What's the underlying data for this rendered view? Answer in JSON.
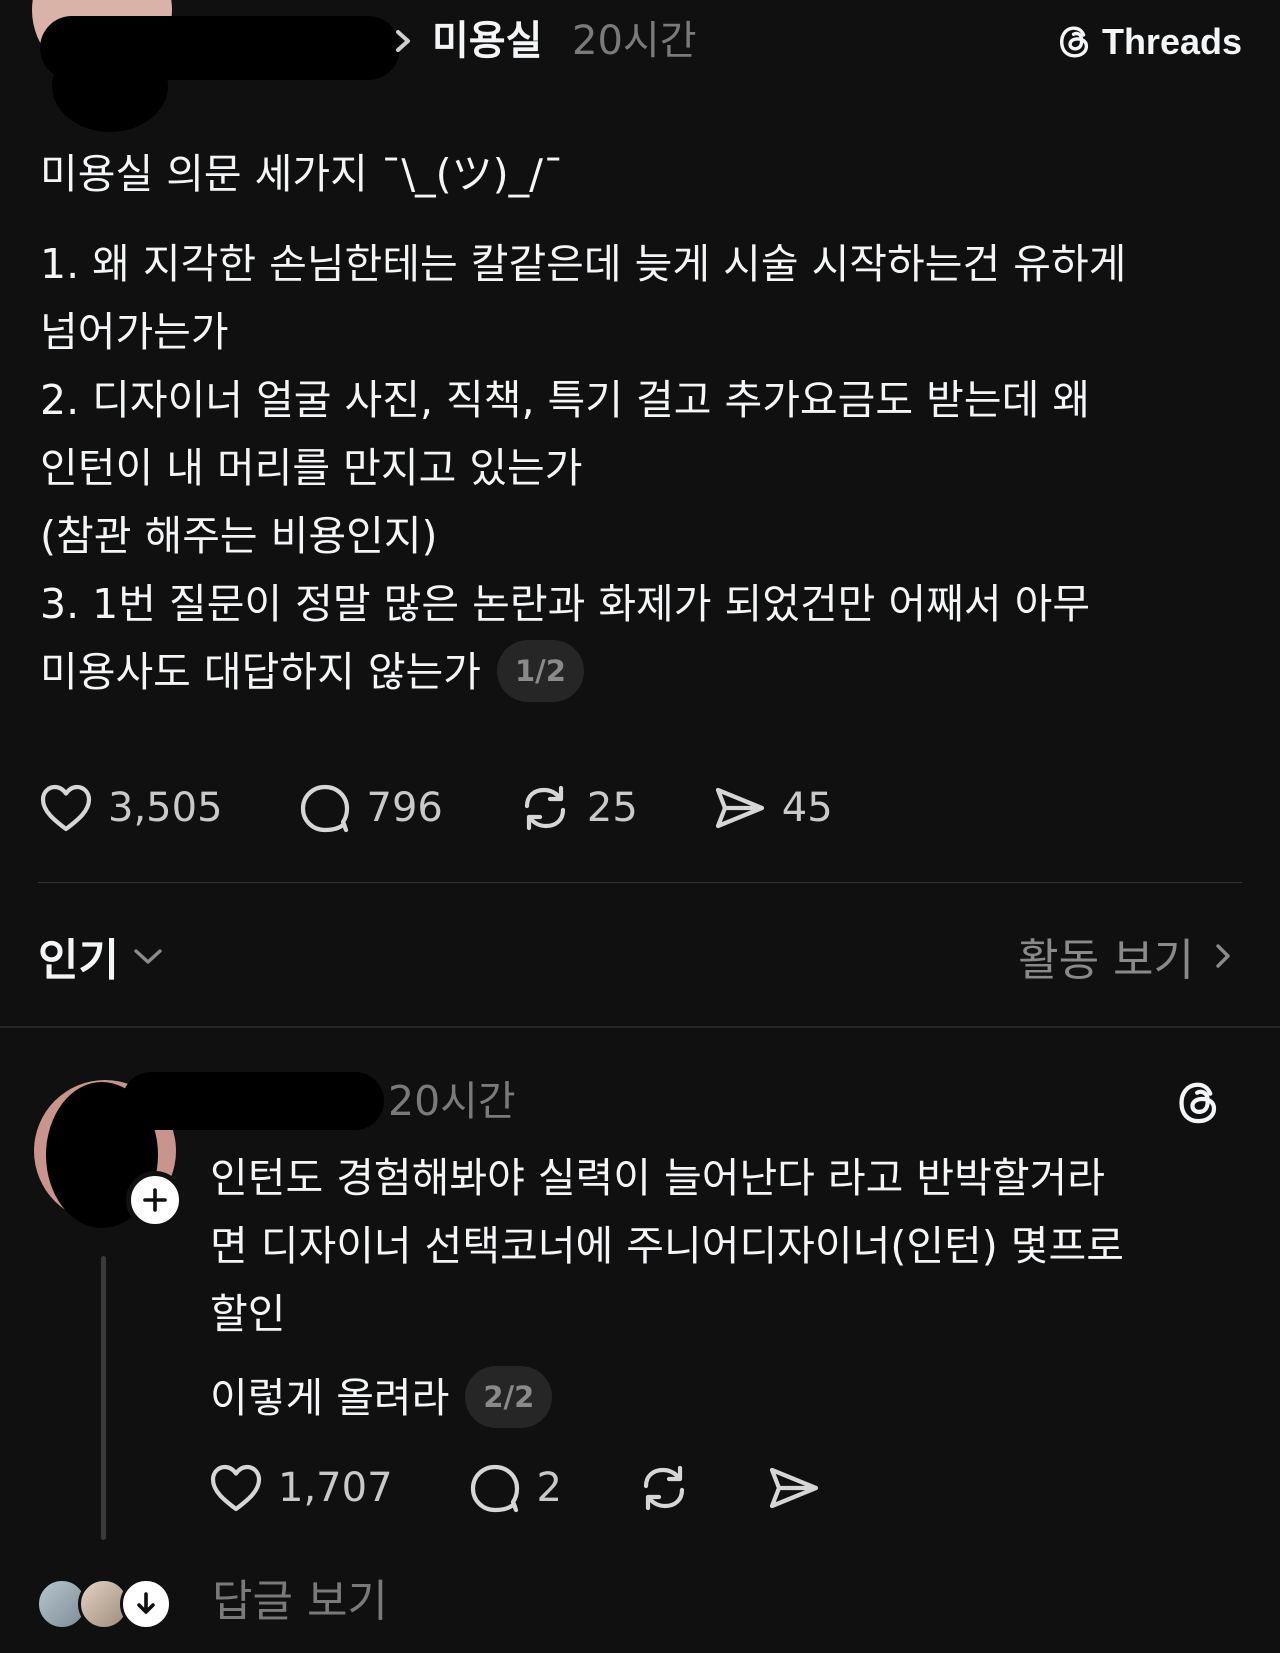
{
  "header": {
    "category": "미용실",
    "time": "20시간",
    "app_badge": "Threads",
    "redacted_username": true
  },
  "post": {
    "title": "미용실 의문 세가지 ¯\\_(ツ)_/¯",
    "lines": [
      "1. 왜 지각한 손님한테는 칼같은데 늦게 시술 시작하는건 유하게",
      "넘어가는가",
      "2. 디자이너 얼굴 사진, 직책, 특기 걸고 추가요금도 받는데 왜",
      "인턴이 내 머리를 만지고 있는가",
      "(참관 해주는 비용인지)",
      "3. 1번 질문이 정말 많은 논란과 화제가 되었건만  어째서 아무"
    ],
    "last_line": "미용사도 대답하지 않는가",
    "pager": "1/2",
    "likes": "3,505",
    "comments": "796",
    "reposts": "25",
    "shares": "45"
  },
  "sort": {
    "label": "인기",
    "activity_label": "활동 보기"
  },
  "reply": {
    "time": "20시간",
    "lines": [
      "인턴도 경험해봐야 실력이 늘어난다 라고 반박할거라",
      "면 디자이너 선택코너에 주니어디자이너(인턴) 몇프로",
      "할인"
    ],
    "last_line": "이렇게 올려라",
    "pager": "2/2",
    "likes": "1,707",
    "comments": "2"
  },
  "view_replies": {
    "label": "답글 보기"
  },
  "colors": {
    "background": "#101010",
    "text_primary": "#f3f5f7",
    "text_secondary": "#7a7a7a",
    "pill_bg": "#262626"
  }
}
